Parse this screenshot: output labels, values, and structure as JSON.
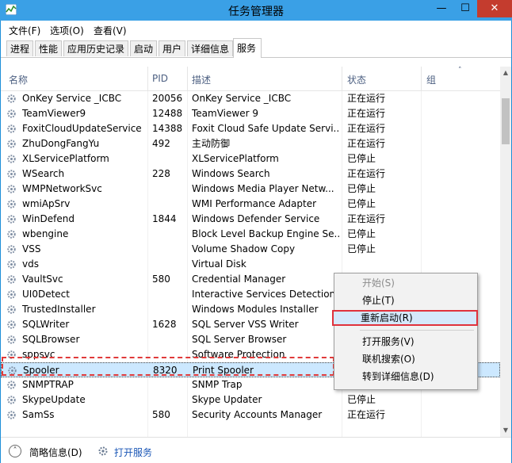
{
  "window": {
    "title": "任务管理器",
    "controls": {
      "minimize": "—",
      "maximize": "☐",
      "close": "✕"
    }
  },
  "menu": [
    "文件(F)",
    "选项(O)",
    "查看(V)"
  ],
  "tabs": [
    "进程",
    "性能",
    "应用历史记录",
    "启动",
    "用户",
    "详细信息",
    "服务"
  ],
  "active_tab": "服务",
  "columns": {
    "name": "名称",
    "pid": "PID",
    "desc": "描述",
    "status": "状态",
    "group": "组"
  },
  "services": [
    {
      "name": "OnKey Service _ICBC",
      "pid": "20056",
      "desc": "OnKey Service _ICBC",
      "status": "正在运行"
    },
    {
      "name": "TeamViewer9",
      "pid": "12488",
      "desc": "TeamViewer 9",
      "status": "正在运行"
    },
    {
      "name": "FoxitCloudUpdateService",
      "pid": "14388",
      "desc": "Foxit Cloud Safe Update Servi...",
      "status": "正在运行"
    },
    {
      "name": "ZhuDongFangYu",
      "pid": "492",
      "desc": "主动防御",
      "status": "正在运行"
    },
    {
      "name": "XLServicePlatform",
      "pid": "",
      "desc": "XLServicePlatform",
      "status": "已停止"
    },
    {
      "name": "WSearch",
      "pid": "228",
      "desc": "Windows Search",
      "status": "正在运行"
    },
    {
      "name": "WMPNetworkSvc",
      "pid": "",
      "desc": "Windows Media Player Netw...",
      "status": "已停止"
    },
    {
      "name": "wmiApSrv",
      "pid": "",
      "desc": "WMI Performance Adapter",
      "status": "已停止"
    },
    {
      "name": "WinDefend",
      "pid": "1844",
      "desc": "Windows Defender Service",
      "status": "正在运行"
    },
    {
      "name": "wbengine",
      "pid": "",
      "desc": "Block Level Backup Engine Se...",
      "status": "已停止"
    },
    {
      "name": "VSS",
      "pid": "",
      "desc": "Volume Shadow Copy",
      "status": "已停止"
    },
    {
      "name": "vds",
      "pid": "",
      "desc": "Virtual Disk",
      "status": ""
    },
    {
      "name": "VaultSvc",
      "pid": "580",
      "desc": "Credential Manager",
      "status": ""
    },
    {
      "name": "UI0Detect",
      "pid": "",
      "desc": "Interactive Services Detection",
      "status": ""
    },
    {
      "name": "TrustedInstaller",
      "pid": "",
      "desc": "Windows Modules Installer",
      "status": ""
    },
    {
      "name": "SQLWriter",
      "pid": "1628",
      "desc": "SQL Server VSS Writer",
      "status": ""
    },
    {
      "name": "SQLBrowser",
      "pid": "",
      "desc": "SQL Server Browser",
      "status": ""
    },
    {
      "name": "sppsvc",
      "pid": "",
      "desc": "Software Protection",
      "status": ""
    },
    {
      "name": "Spooler",
      "pid": "8320",
      "desc": "Print Spooler",
      "status": "正在运行"
    },
    {
      "name": "SNMPTRAP",
      "pid": "",
      "desc": "SNMP Trap",
      "status": "已停止"
    },
    {
      "name": "SkypeUpdate",
      "pid": "",
      "desc": "Skype Updater",
      "status": "已停止"
    },
    {
      "name": "SamSs",
      "pid": "580",
      "desc": "Security Accounts Manager",
      "status": "正在运行"
    }
  ],
  "context_menu": {
    "start": "开始(S)",
    "stop": "停止(T)",
    "restart": "重新启动(R)",
    "open_services": "打开服务(V)",
    "search_online": "联机搜索(O)",
    "goto_details": "转到详细信息(D)"
  },
  "footer": {
    "fewer_details": "简略信息(D)",
    "open_services": "打开服务"
  },
  "colors": {
    "selection": "#cce8ff",
    "highlight": "#e0323c",
    "title_bar": "#3aa0e6"
  }
}
